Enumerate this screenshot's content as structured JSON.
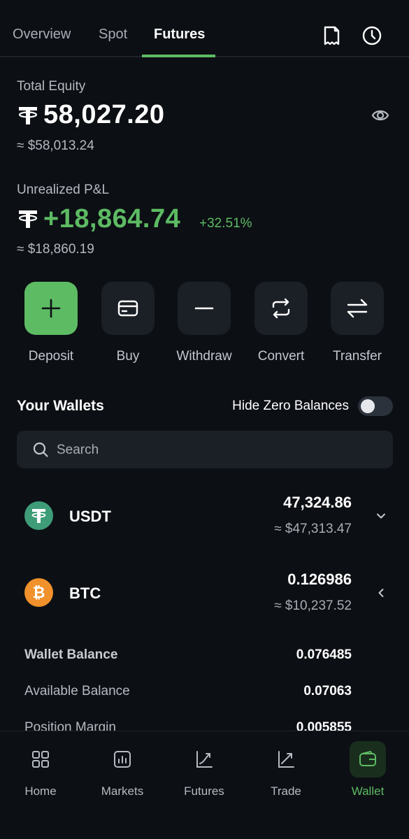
{
  "tabs": [
    {
      "label": "Overview",
      "active": false
    },
    {
      "label": "Spot",
      "active": false
    },
    {
      "label": "Futures",
      "active": true
    }
  ],
  "header_icons": [
    "receipt-icon",
    "history-clock-icon"
  ],
  "equity": {
    "label": "Total Equity",
    "amount": "58,027.20",
    "usd": "≈ $58,013.24"
  },
  "pnl": {
    "label": "Unrealized P&L",
    "amount": "+18,864.74",
    "percent": "+32.51%",
    "usd": "≈ $18,860.19"
  },
  "actions": [
    {
      "label": "Deposit",
      "icon": "plus-icon"
    },
    {
      "label": "Buy",
      "icon": "card-icon"
    },
    {
      "label": "Withdraw",
      "icon": "minus-icon"
    },
    {
      "label": "Convert",
      "icon": "convert-icon"
    },
    {
      "label": "Transfer",
      "icon": "transfer-icon"
    }
  ],
  "wallets": {
    "title": "Your Wallets",
    "hide_zero_label": "Hide Zero Balances",
    "hide_zero_enabled": false,
    "search_placeholder": "Search",
    "coins": [
      {
        "symbol": "USDT",
        "amount": "47,324.86",
        "usd": "≈ $47,313.47",
        "color": "#3e9c78",
        "expanded": false
      },
      {
        "symbol": "BTC",
        "amount": "0.126986",
        "usd": "≈ $10,237.52",
        "color": "#f0912b",
        "expanded": true
      }
    ],
    "btc_details": [
      {
        "label": "Wallet Balance",
        "value": "0.076485"
      },
      {
        "label": "Available Balance",
        "value": "0.07063"
      },
      {
        "label": "Position Margin",
        "value": "0.005855"
      }
    ]
  },
  "nav": [
    {
      "label": "Home",
      "icon": "grid-icon",
      "active": false
    },
    {
      "label": "Markets",
      "icon": "chart-icon",
      "active": false
    },
    {
      "label": "Futures",
      "icon": "futures-icon",
      "active": false
    },
    {
      "label": "Trade",
      "icon": "trade-icon",
      "active": false
    },
    {
      "label": "Wallet",
      "icon": "wallet-icon",
      "active": true
    }
  ],
  "colors": {
    "accent": "#5dbb63",
    "background": "#0c0f14",
    "surface": "#1b1f26"
  }
}
